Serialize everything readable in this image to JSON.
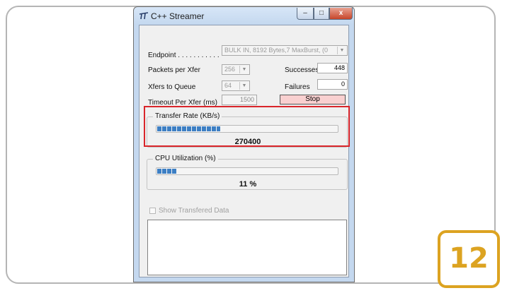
{
  "window": {
    "title": "C++ Streamer",
    "controls": {
      "minimize": "–",
      "maximize": "□",
      "close": "x"
    }
  },
  "form": {
    "endpoint_label": "Endpoint . . . . . . . . . . .",
    "endpoint_value": "BULK IN,     8192 Bytes,7 MaxBurst,   (0",
    "packets_label": "Packets per Xfer",
    "packets_value": "256",
    "xfers_label": "Xfers to Queue",
    "xfers_value": "64",
    "timeout_label": "Timeout Per Xfer (ms)",
    "timeout_value": "1500",
    "successes_label": "Successes",
    "successes_value": "448",
    "failures_label": "Failures",
    "failures_value": "0",
    "stop_label": "Stop"
  },
  "transfer_rate": {
    "title": "Transfer Rate (KB/s)",
    "value": "270400",
    "fill_fraction": 0.35
  },
  "cpu": {
    "title": "CPU Utilization (%)",
    "value": "11 %",
    "fill_fraction": 0.11
  },
  "show_data": {
    "label": "Show Transfered Data",
    "checked": false
  },
  "step_badge": "12",
  "colors": {
    "highlight": "#d9252a",
    "badge": "#dca321",
    "progress": "#3d7fc4",
    "stop_button": "#f9d0d0"
  },
  "icons": [
    "app-icon",
    "minimize-icon",
    "maximize-icon",
    "close-icon",
    "dropdown-arrow-icon"
  ]
}
